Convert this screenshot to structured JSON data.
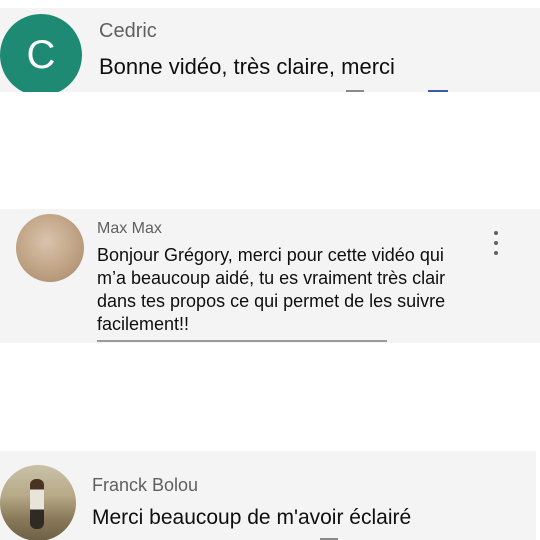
{
  "comments": [
    {
      "avatar_letter": "C",
      "author": "Cedric",
      "text": "Bonne vidéo, très claire, merci"
    },
    {
      "author": "Max Max",
      "text": "Bonjour Grégory, merci pour cette vidéo qui m’a beaucoup aidé, tu es vraiment très clair dans tes propos ce qui permet de les suivre facilement!!",
      "menu_icon": "more-vert-icon"
    },
    {
      "author": "Franck Bolou",
      "text": "Merci beaucoup de m'avoir éclairé"
    }
  ],
  "colors": {
    "card_background": "#f4f4f4",
    "avatar_teal": "#1e8a73",
    "author_gray": "#606060"
  }
}
